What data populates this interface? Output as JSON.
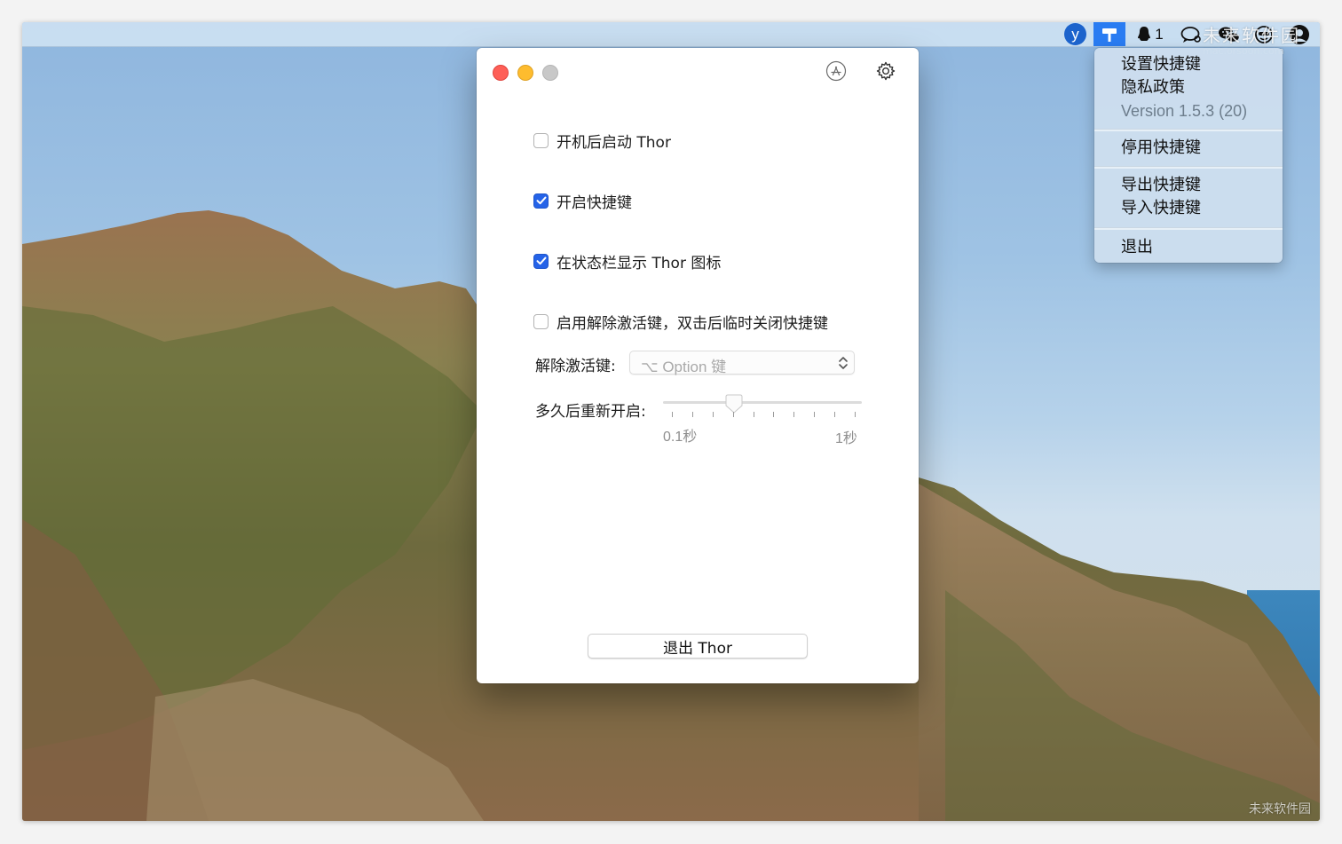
{
  "menubar": {
    "y_label": "y",
    "qq_count": "1",
    "watermark_top": "未来软件园",
    "watermark_top_sub": "mac.orsoon.com",
    "watermark_bottom": "未来软件园"
  },
  "status_menu": {
    "items": [
      "设置快捷键",
      "隐私政策",
      "Version 1.5.3 (20)",
      "停用快捷键",
      "导出快捷键",
      "导入快捷键",
      "退出"
    ]
  },
  "window": {
    "options": [
      {
        "label": "开机后启动 Thor",
        "checked": false
      },
      {
        "label": "开启快捷键",
        "checked": true
      },
      {
        "label": "在状态栏显示 Thor 图标",
        "checked": true
      },
      {
        "label": "启用解除激活键，双击后临时关闭快捷键",
        "checked": false
      }
    ],
    "deactivate_key_label": "解除激活键:",
    "deactivate_key_value": "⌥ Option 键",
    "reenable_label": "多久后重新开启:",
    "slider_min": "0.1秒",
    "slider_max": "1秒",
    "slider_value_fraction": 0.34,
    "quit_button": "退出 Thor"
  },
  "colors": {
    "checkbox_on": "#2563e8",
    "traffic_close": "#fe5f57",
    "traffic_min": "#febc2e",
    "traffic_max": "#c8c8c8",
    "menubar_highlight": "#2a7cf2"
  }
}
